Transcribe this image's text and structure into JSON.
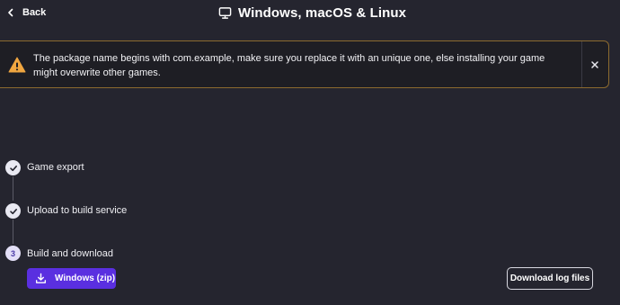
{
  "header": {
    "back_label": "Back",
    "title": "Windows, macOS & Linux",
    "back_icon": "chevron-left-icon",
    "title_icon": "monitor-icon"
  },
  "banner": {
    "message": "The package name begins with com.example, make sure you replace it with an unique one, else installing your game might overwrite other games.",
    "icon": "warning-icon",
    "close_icon": "close-icon",
    "accent_color": "#f0a640"
  },
  "steps": [
    {
      "label": "Game export",
      "status": "done"
    },
    {
      "label": "Upload to build service",
      "status": "done"
    },
    {
      "label": "Build and download",
      "status": "current",
      "number": "3"
    }
  ],
  "actions": {
    "primary_label": "Windows (zip)",
    "primary_icon": "download-icon",
    "primary_color": "#5a2fe0",
    "secondary_label": "Download log files"
  }
}
